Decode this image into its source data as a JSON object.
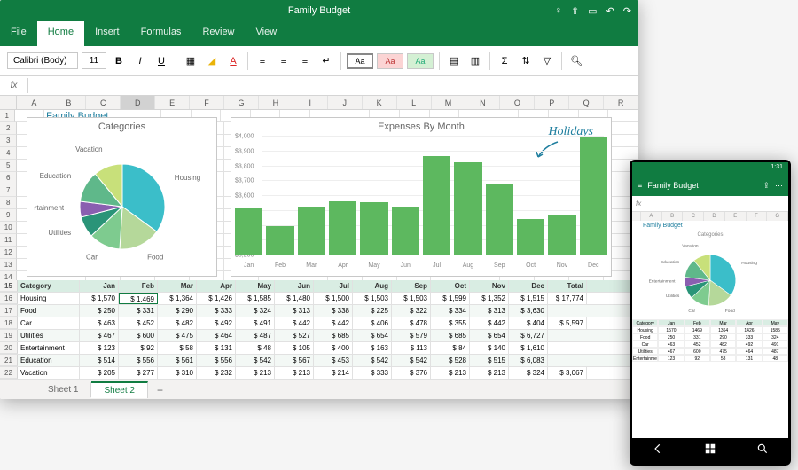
{
  "app_title": "Family Budget",
  "ribbon": {
    "tabs": [
      "File",
      "Home",
      "Insert",
      "Formulas",
      "Review",
      "View"
    ],
    "active": "Home"
  },
  "toolbar": {
    "font": "Calibri (Body)",
    "size": "11",
    "swatches": [
      "Aa",
      "Aa",
      "Aa"
    ]
  },
  "columns": [
    "A",
    "B",
    "C",
    "D",
    "E",
    "F",
    "G",
    "H",
    "I",
    "J",
    "K",
    "L",
    "M",
    "N",
    "O",
    "P",
    "Q",
    "R"
  ],
  "title_cell": "Family Budget",
  "chart_data": [
    {
      "type": "pie",
      "title": "Categories",
      "series": [
        {
          "name": "Housing",
          "value": 35,
          "color": "#3bbec9"
        },
        {
          "name": "Food",
          "value": 16,
          "color": "#b5d89a"
        },
        {
          "name": "Car",
          "value": 12,
          "color": "#7ecb8f"
        },
        {
          "name": "Utilities",
          "value": 8,
          "color": "#2a9478"
        },
        {
          "name": "Entertainment",
          "value": 6,
          "color": "#8a5fb0"
        },
        {
          "name": "Education",
          "value": 12,
          "color": "#5fb88a"
        },
        {
          "name": "Vacation",
          "value": 11,
          "color": "#c8e07a"
        }
      ]
    },
    {
      "type": "bar",
      "title": "Expenses By Month",
      "categories": [
        "Jan",
        "Feb",
        "Mar",
        "Apr",
        "May",
        "Jun",
        "Jul",
        "Aug",
        "Sep",
        "Oct",
        "Nov",
        "Dec"
      ],
      "values": [
        3515,
        3390,
        3520,
        3560,
        3550,
        3525,
        3860,
        3820,
        3680,
        3440,
        3470,
        3990
      ],
      "ylim": [
        3200,
        4000
      ],
      "yticks": [
        3200,
        3300,
        3400,
        3500,
        3600,
        3700,
        3800,
        3900,
        4000
      ],
      "annotation": "Holidays"
    }
  ],
  "table": {
    "header": [
      "Category",
      "Jan",
      "Feb",
      "Mar",
      "Apr",
      "May",
      "Jun",
      "Jul",
      "Aug",
      "Sep",
      "Oct",
      "Nov",
      "Dec",
      "Total"
    ],
    "rows": [
      [
        "Housing",
        "1,570",
        "1,469",
        "1,364",
        "1,426",
        "1,585",
        "1,480",
        "1,500",
        "1,503",
        "1,503",
        "1,599",
        "1,352",
        "1,515",
        "17,774"
      ],
      [
        "Food",
        "250",
        "331",
        "290",
        "333",
        "324",
        "313",
        "338",
        "225",
        "322",
        "334",
        "313",
        "3,630"
      ],
      [
        "Car",
        "463",
        "452",
        "482",
        "492",
        "491",
        "442",
        "442",
        "406",
        "478",
        "355",
        "442",
        "404",
        "5,597"
      ],
      [
        "Utilities",
        "467",
        "600",
        "475",
        "464",
        "487",
        "527",
        "685",
        "654",
        "579",
        "685",
        "654",
        "6,727"
      ],
      [
        "Entertainment",
        "123",
        "92",
        "58",
        "131",
        "48",
        "105",
        "400",
        "163",
        "113",
        "84",
        "140",
        "1,610"
      ],
      [
        "Education",
        "514",
        "556",
        "561",
        "556",
        "542",
        "567",
        "453",
        "542",
        "542",
        "528",
        "515",
        "6,083"
      ],
      [
        "Vacation",
        "205",
        "277",
        "310",
        "232",
        "213",
        "213",
        "214",
        "333",
        "376",
        "213",
        "213",
        "324",
        "3,067"
      ]
    ],
    "row_numbers": [
      15,
      16,
      17,
      18,
      19,
      20,
      21,
      22
    ]
  },
  "sheets": {
    "tabs": [
      "Sheet 1",
      "Sheet 2"
    ],
    "active": "Sheet 2"
  },
  "mobile": {
    "time": "1:31",
    "title": "Family Budget",
    "pie_title": "Categories",
    "table_head": [
      "Category",
      "Jan",
      "Feb",
      "Mar",
      "Apr",
      "May"
    ],
    "table_rows": [
      [
        "Housing",
        "1570",
        "1469",
        "1364",
        "1426",
        "1585"
      ],
      [
        "Food",
        "250",
        "331",
        "290",
        "333",
        "324"
      ],
      [
        "Car",
        "463",
        "452",
        "482",
        "492",
        "491"
      ],
      [
        "Utilities",
        "467",
        "600",
        "475",
        "464",
        "487"
      ],
      [
        "Entertainment",
        "123",
        "92",
        "58",
        "131",
        "48"
      ]
    ]
  }
}
